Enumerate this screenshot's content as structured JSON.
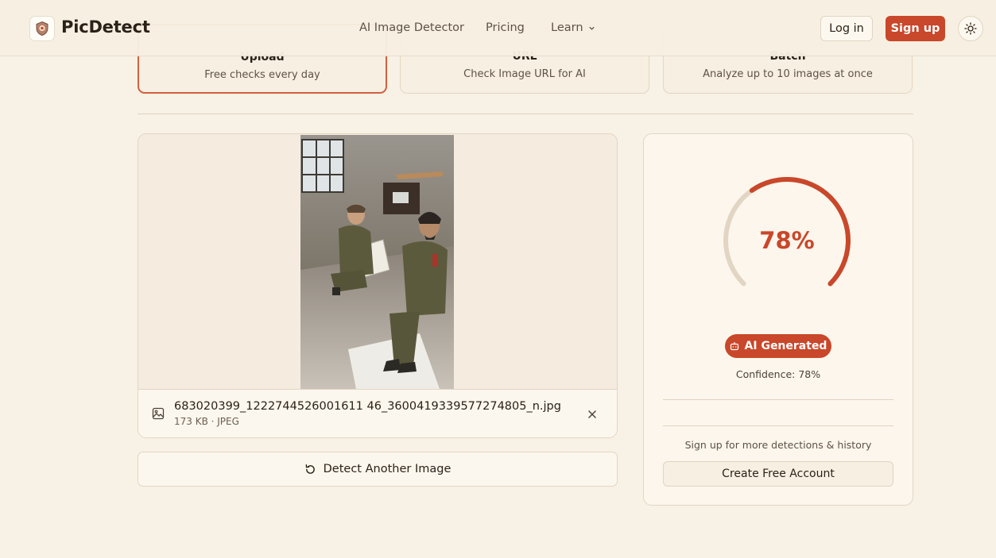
{
  "header": {
    "brand": "PicDetect",
    "nav": {
      "detector": "AI Image Detector",
      "pricing": "Pricing",
      "learn": "Learn"
    },
    "login_label": "Log in",
    "signup_label": "Sign up"
  },
  "modes": [
    {
      "title": "Upload",
      "desc": "Free checks every day"
    },
    {
      "title": "URL",
      "desc": "Check Image URL for AI"
    },
    {
      "title": "Batch",
      "desc": "Analyze up to 10 images at once"
    }
  ],
  "file": {
    "name": "683020399_1222744526001611 46_3600419339577274805_n.jpg",
    "meta": "173 KB · JPEG"
  },
  "detect_again_label": "Detect Another Image",
  "result": {
    "score_text": "78%",
    "score_fraction": 0.78,
    "verdict": "AI Generated",
    "confidence": "Confidence: 78%",
    "signup_note": "Sign up for more detections & history",
    "create_account_label": "Create Free Account"
  },
  "colors": {
    "accent": "#c9472a",
    "background": "#f8f1e5",
    "track": "#e2d5c3"
  },
  "icons": {
    "logo": "shield-eye-icon",
    "theme": "sun-icon",
    "file": "image-icon",
    "close": "close-icon",
    "detect": "rotate-ccw-icon",
    "verdict": "robot-icon"
  }
}
